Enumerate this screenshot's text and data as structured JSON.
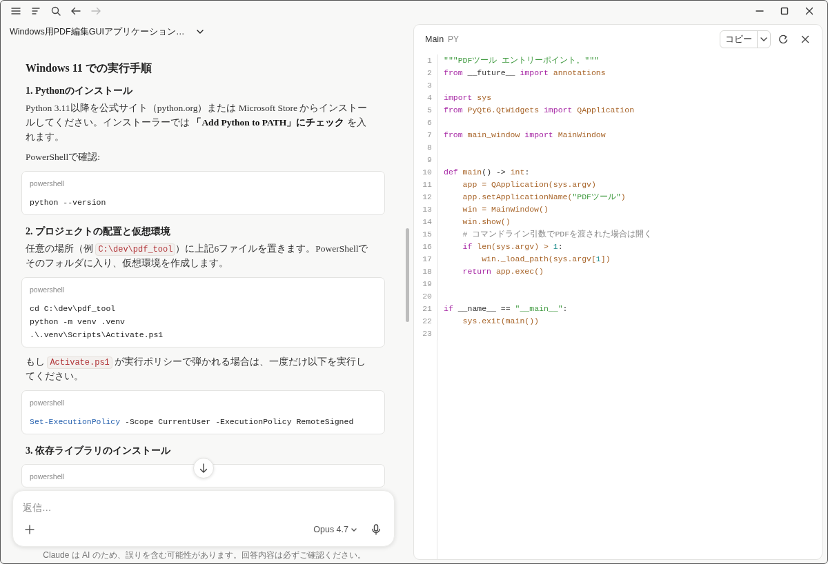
{
  "chat": {
    "title": "Windows用PDF編集GUIアプリケーション…",
    "blocks": [
      {
        "kind": "h2",
        "text": "Windows 11 での実行手順"
      },
      {
        "kind": "h3",
        "text": "1. Pythonのインストール"
      },
      {
        "kind": "p",
        "segments": [
          {
            "kind": "text",
            "text": "Python 3.11以降を公式サイト（python.org）または Microsoft Store からインストールしてください。インストーラーでは "
          },
          {
            "kind": "bold",
            "text": "「Add Python to PATH」にチェック"
          },
          {
            "kind": "text",
            "text": " を入れます。"
          }
        ]
      },
      {
        "kind": "p",
        "segments": [
          {
            "kind": "text",
            "text": "PowerShellで確認:"
          }
        ]
      },
      {
        "kind": "code",
        "lang": "powershell",
        "lines": [
          [
            {
              "kind": "plain",
              "text": "python --version"
            }
          ]
        ]
      },
      {
        "kind": "h3",
        "text": "2. プロジェクトの配置と仮想環境"
      },
      {
        "kind": "p",
        "segments": [
          {
            "kind": "text",
            "text": "任意の場所（例 "
          },
          {
            "kind": "code",
            "text": "C:\\dev\\pdf_tool"
          },
          {
            "kind": "text",
            "text": "）に上記6ファイルを置きます。PowerShellでそのフォルダに入り、仮想環境を作成します。"
          }
        ]
      },
      {
        "kind": "code",
        "lang": "powershell",
        "lines": [
          [
            {
              "kind": "plain",
              "text": "cd C:\\dev\\pdf_tool"
            }
          ],
          [
            {
              "kind": "plain",
              "text": "python -m venv .venv"
            }
          ],
          [
            {
              "kind": "plain",
              "text": ".\\.venv\\Scripts\\Activate.ps1"
            }
          ]
        ]
      },
      {
        "kind": "p",
        "segments": [
          {
            "kind": "text",
            "text": "もし "
          },
          {
            "kind": "code",
            "text": "Activate.ps1"
          },
          {
            "kind": "text",
            "text": " が実行ポリシーで弾かれる場合は、一度だけ以下を実行してください。"
          }
        ]
      },
      {
        "kind": "code",
        "lang": "powershell",
        "lines": [
          [
            {
              "kind": "cmdlet",
              "text": "Set-ExecutionPolicy"
            },
            {
              "kind": "plain",
              "text": " -Scope CurrentUser -ExecutionPolicy RemoteSigned"
            }
          ]
        ]
      },
      {
        "kind": "h3",
        "text": "3. 依存ライブラリのインストール"
      },
      {
        "kind": "code",
        "lang": "powershell"
      }
    ],
    "composer": {
      "placeholder": "返信…",
      "model": "Opus 4.7"
    },
    "disclaimer": "Claude は AI のため、誤りを含む可能性があります。回答内容は必ずご確認ください。"
  },
  "artifact": {
    "name": "Main",
    "type": "PY",
    "copy_label": "コピー",
    "lines": [
      {
        "number": "1",
        "tokens": [
          {
            "kind": "str",
            "text": "\"\"\"PDFツール エントリーポイント。\"\"\""
          }
        ]
      },
      {
        "number": "2",
        "tokens": [
          {
            "kind": "kw",
            "text": "from"
          },
          {
            "kind": "plain",
            "text": " __future__ "
          },
          {
            "kind": "kw",
            "text": "import"
          },
          {
            "kind": "id",
            "text": " annotations"
          }
        ]
      },
      {
        "number": "3"
      },
      {
        "number": "4",
        "tokens": [
          {
            "kind": "kw",
            "text": "import"
          },
          {
            "kind": "id",
            "text": " sys"
          }
        ]
      },
      {
        "number": "5",
        "tokens": [
          {
            "kind": "kw",
            "text": "from"
          },
          {
            "kind": "id",
            "text": " PyQt6.QtWidgets "
          },
          {
            "kind": "kw",
            "text": "import"
          },
          {
            "kind": "id",
            "text": " QApplication"
          }
        ]
      },
      {
        "number": "6"
      },
      {
        "number": "7",
        "tokens": [
          {
            "kind": "kw",
            "text": "from"
          },
          {
            "kind": "id",
            "text": " main_window "
          },
          {
            "kind": "kw",
            "text": "import"
          },
          {
            "kind": "id",
            "text": " MainWindow"
          }
        ]
      },
      {
        "number": "8"
      },
      {
        "number": "9"
      },
      {
        "number": "10",
        "tokens": [
          {
            "kind": "kw",
            "text": "def"
          },
          {
            "kind": "id",
            "text": " main"
          },
          {
            "kind": "plain",
            "text": "() -> "
          },
          {
            "kind": "id",
            "text": "int"
          },
          {
            "kind": "plain",
            "text": ":"
          }
        ]
      },
      {
        "number": "11",
        "tokens": [
          {
            "kind": "id",
            "text": "    app = QApplication(sys.argv)"
          }
        ]
      },
      {
        "number": "12",
        "tokens": [
          {
            "kind": "id",
            "text": "    app.setApplicationName("
          },
          {
            "kind": "str",
            "text": "\"PDFツール\""
          },
          {
            "kind": "id",
            "text": ")"
          }
        ]
      },
      {
        "number": "13",
        "tokens": [
          {
            "kind": "id",
            "text": "    win = MainWindow()"
          }
        ]
      },
      {
        "number": "14",
        "tokens": [
          {
            "kind": "id",
            "text": "    win.show()"
          }
        ]
      },
      {
        "number": "15",
        "tokens": [
          {
            "kind": "comment",
            "text": "    # コマンドライン引数でPDFを渡された場合は開く"
          }
        ]
      },
      {
        "number": "16",
        "tokens": [
          {
            "kind": "kw",
            "text": "    if"
          },
          {
            "kind": "id",
            "text": " len(sys.argv) > "
          },
          {
            "kind": "num",
            "text": "1"
          },
          {
            "kind": "plain",
            "text": ":"
          }
        ]
      },
      {
        "number": "17",
        "tokens": [
          {
            "kind": "id",
            "text": "        win._load_path(sys.argv["
          },
          {
            "kind": "num",
            "text": "1"
          },
          {
            "kind": "id",
            "text": "])"
          }
        ]
      },
      {
        "number": "18",
        "tokens": [
          {
            "kind": "kw",
            "text": "    return"
          },
          {
            "kind": "id",
            "text": " app.exec()"
          }
        ]
      },
      {
        "number": "19"
      },
      {
        "number": "20"
      },
      {
        "number": "21",
        "tokens": [
          {
            "kind": "kw",
            "text": "if"
          },
          {
            "kind": "plain",
            "text": " __name__ == "
          },
          {
            "kind": "str",
            "text": "\"__main__\""
          },
          {
            "kind": "plain",
            "text": ":"
          }
        ]
      },
      {
        "number": "22",
        "tokens": [
          {
            "kind": "id",
            "text": "    sys.exit(main())"
          }
        ]
      },
      {
        "number": "23"
      }
    ]
  }
}
